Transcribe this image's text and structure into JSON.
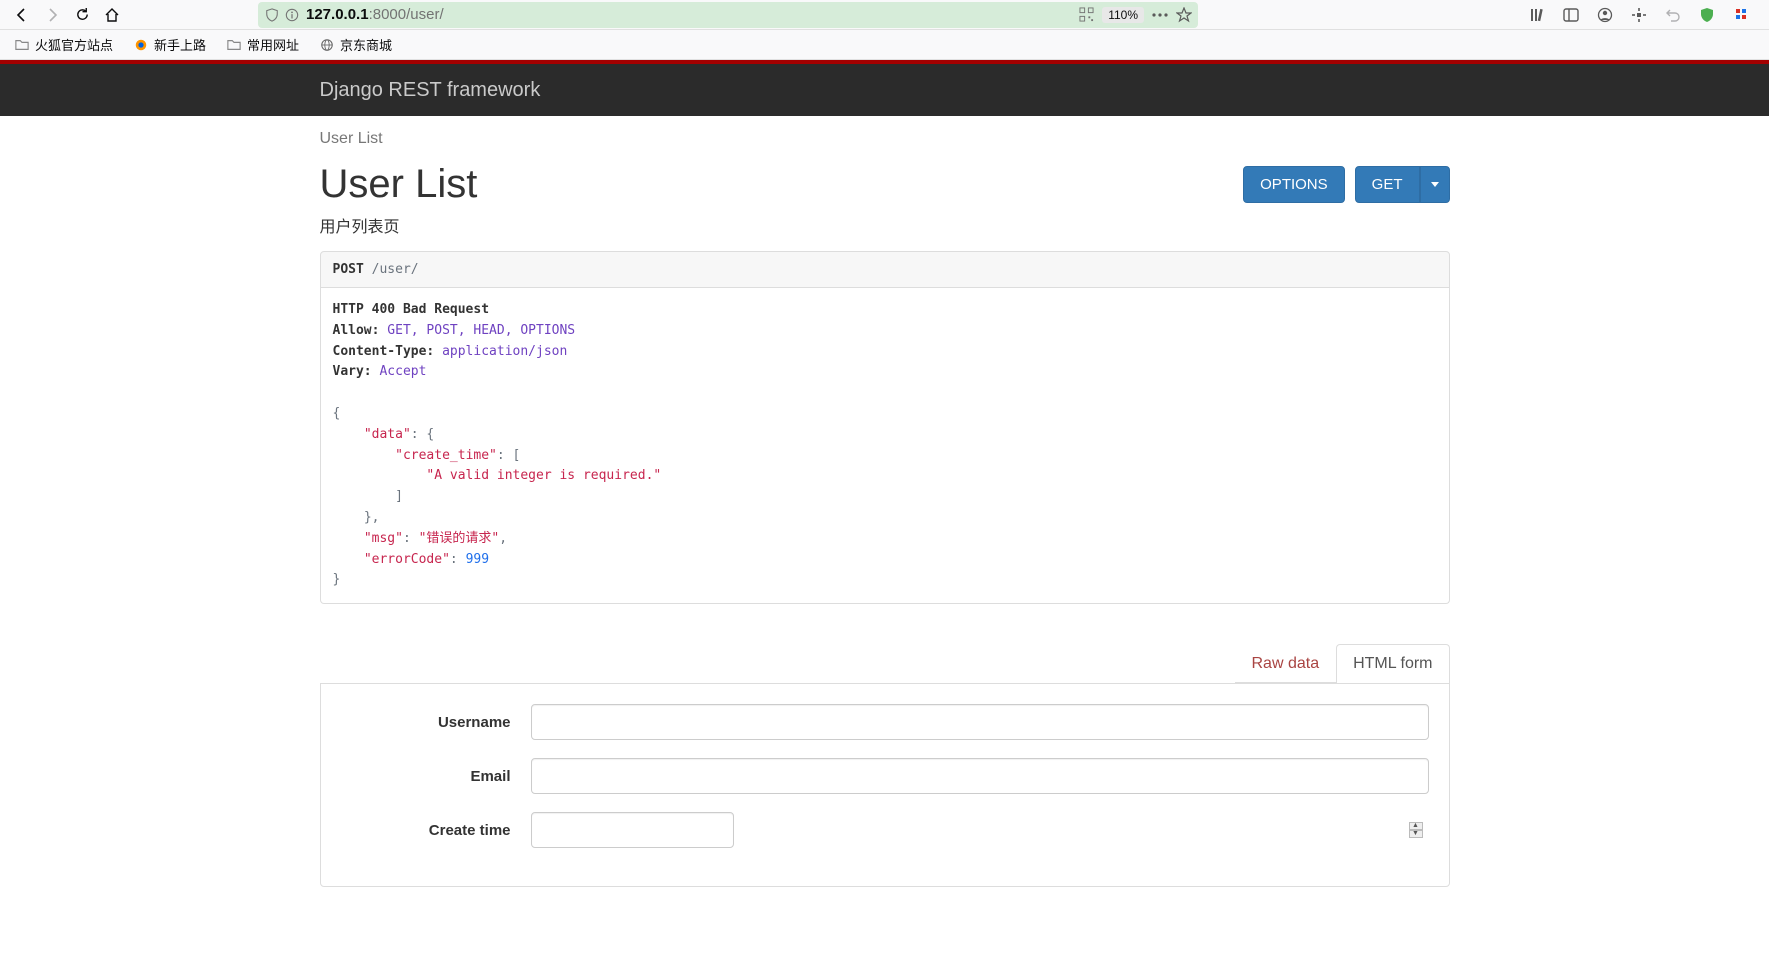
{
  "browser": {
    "url_host": "127.0.0.1",
    "url_port_path": ":8000/user/",
    "zoom": "110%",
    "bookmarks": [
      {
        "label": "火狐官方站点",
        "icon": "folder"
      },
      {
        "label": "新手上路",
        "icon": "firefox"
      },
      {
        "label": "常用网址",
        "icon": "folder"
      },
      {
        "label": "京东商城",
        "icon": "globe"
      }
    ]
  },
  "navbar": {
    "brand": "Django REST framework"
  },
  "breadcrumb": {
    "item": "User List"
  },
  "header": {
    "title": "User List",
    "description": "用户列表页",
    "options_btn": "OPTIONS",
    "get_btn": "GET"
  },
  "request": {
    "method": "POST",
    "path": "/user/"
  },
  "response": {
    "status_line": "HTTP 400 Bad Request",
    "allow_label": "Allow:",
    "allow_value": "GET, POST, HEAD, OPTIONS",
    "content_type_label": "Content-Type:",
    "content_type_value": "application/json",
    "vary_label": "Vary:",
    "vary_value": "Accept",
    "body": {
      "data_key": "\"data\"",
      "create_time_key": "\"create_time\"",
      "create_time_err": "\"A valid integer is required.\"",
      "msg_key": "\"msg\"",
      "msg_val": "\"错误的请求\"",
      "errorCode_key": "\"errorCode\"",
      "errorCode_val": "999"
    }
  },
  "tabs": {
    "raw": "Raw data",
    "htmlform": "HTML form"
  },
  "form": {
    "username_label": "Username",
    "email_label": "Email",
    "create_time_label": "Create time",
    "username_value": "",
    "email_value": "",
    "create_time_value": ""
  }
}
